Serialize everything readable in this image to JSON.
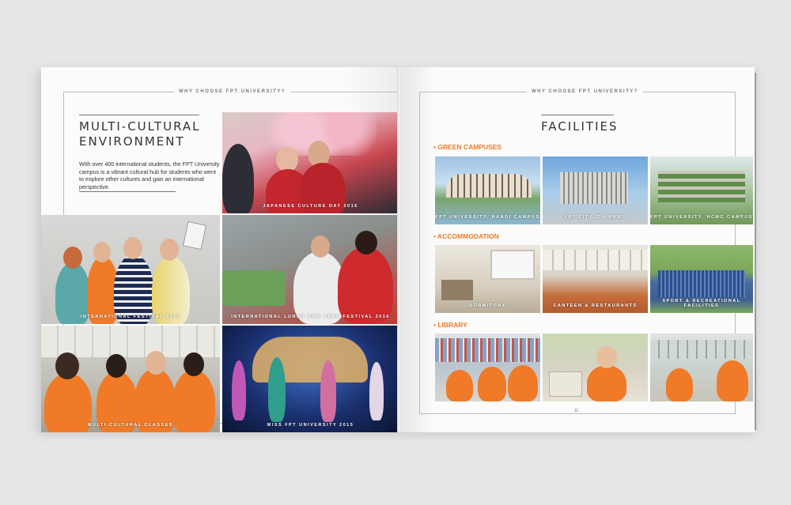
{
  "left_page": {
    "header": "WHY CHOOSE FPT UNIVERSITY?",
    "title_line1": "MULTI-CULTURAL",
    "title_line2": "ENVIRONMENT",
    "intro": "With over 400 international students, the FPT University campus is a vibrant cultural hub for students who went to explore other cultures and gain an international perspective.",
    "photos": [
      {
        "caption": "JAPANESE CULTURE DAY 2016"
      },
      {
        "caption": "INTERNATIONAL FESTIVAL 2015"
      },
      {
        "caption": "INTERNATIONAL LUNAR NEW YEAR FESTIVAL 2016"
      },
      {
        "caption": "MULTI-CULTURAL CLASSES"
      },
      {
        "caption": "MISS FPT UNIVERSITY 2015"
      }
    ]
  },
  "right_page": {
    "header": "WHY CHOOSE FPT UNIVERSITY?",
    "title": "FACILITIES",
    "page_number": "11",
    "sections": [
      {
        "label": "• GREEN CAMPUSES",
        "captions": [
          "FPT UNIVERSITY, HANOI CAMPUS",
          "FPT CITY, DA NANG",
          "FPT UNIVERSITY, HCMC CAMPUS"
        ]
      },
      {
        "label": "• ACCOMMODATION",
        "captions": [
          "DORMITORY",
          "CANTEEN & RESTAURANTS",
          "SPORT & RECREATIONAL FACILITIES"
        ]
      },
      {
        "label": "• LIBRARY",
        "captions": [
          "",
          "",
          ""
        ]
      }
    ]
  },
  "colors": {
    "accent": "#f07a28",
    "text": "#333333",
    "frame": "#bbbbbb"
  }
}
